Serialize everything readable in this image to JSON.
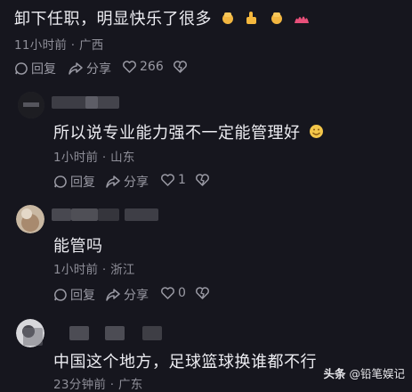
{
  "comments": [
    {
      "text": "卸下任职，明显快乐了很多",
      "meta": "11小时前 · 广西",
      "reply_label": "回复",
      "share_label": "分享",
      "likes": "266"
    },
    {
      "text": "所以说专业能力强不一定能管理好",
      "meta": "1小时前 · 山东",
      "reply_label": "回复",
      "share_label": "分享",
      "likes": "1"
    },
    {
      "text": "能管吗",
      "meta": "1小时前 · 浙江",
      "reply_label": "回复",
      "share_label": "分享",
      "likes": "0"
    },
    {
      "text": "中国这个地方，足球篮球换谁都不行",
      "meta": "23分钟前 · 广东"
    }
  ],
  "watermark": {
    "source": "头条",
    "account": "@铅笔娱记"
  }
}
